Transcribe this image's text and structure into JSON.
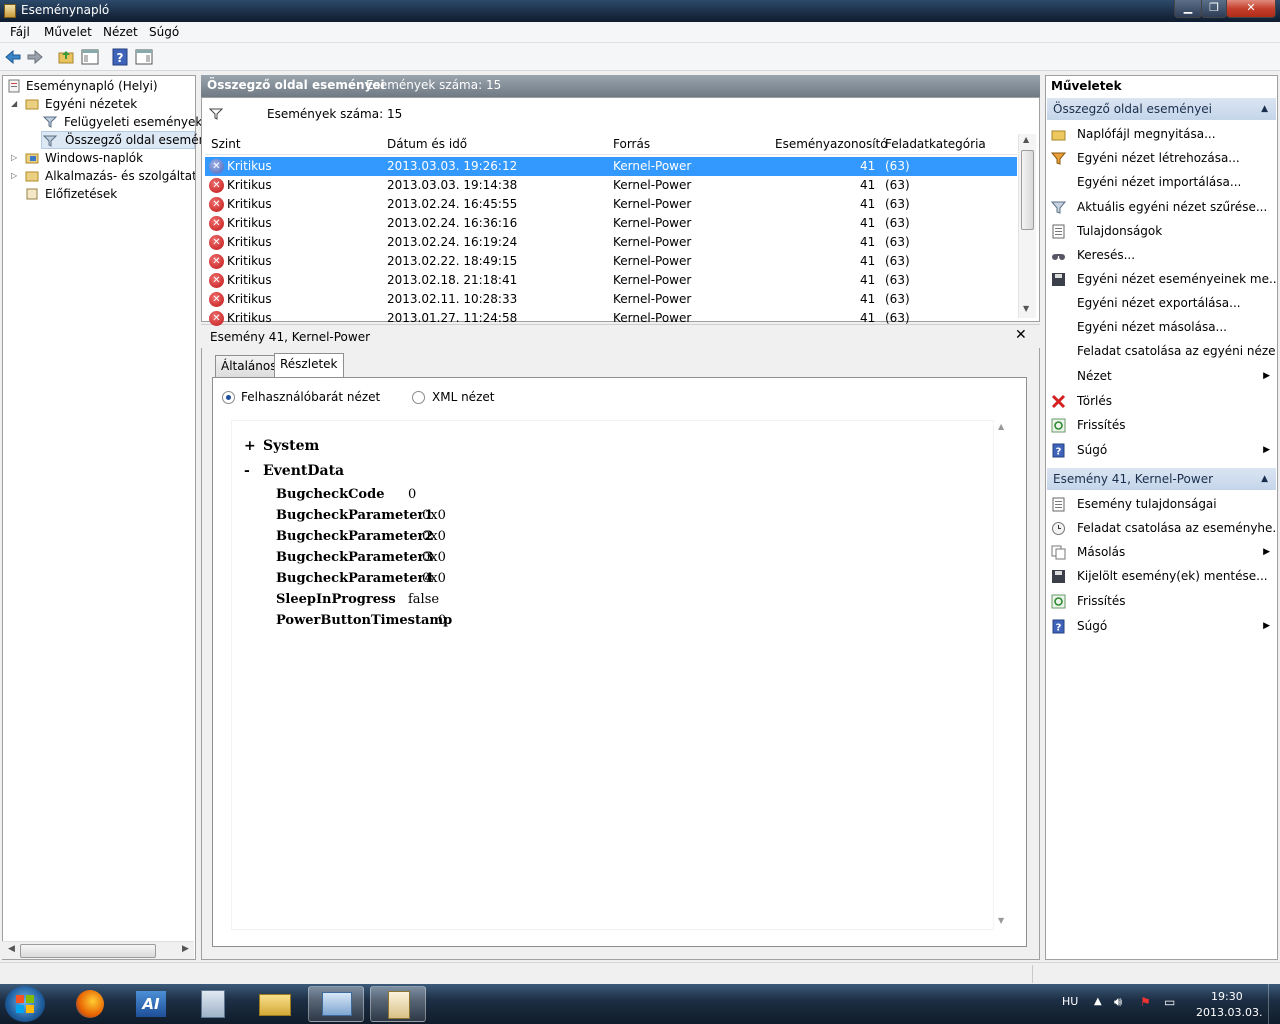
{
  "window": {
    "title": "Eseménynapló"
  },
  "menu": [
    "Fájl",
    "Művelet",
    "Nézet",
    "Súgó"
  ],
  "toolbar": {
    "buttons": [
      "back-icon",
      "forward-icon",
      "folder-up-icon",
      "show-hide-tree-icon",
      "help-icon",
      "show-hide-actions-icon"
    ]
  },
  "tree": {
    "root": "Eseménynapló (Helyi)",
    "custom_views": "Egyéni nézetek",
    "admin_events": "Felügyeleti események",
    "summary_events": "Összegző oldal eseménye",
    "windows_logs": "Windows-naplók",
    "app_service_logs": "Alkalmazás- és szolgáltatásn",
    "subscriptions": "Előfizetések"
  },
  "center": {
    "header_title": "Összegző oldal eseményei",
    "header_count": "Események száma: 15",
    "filter_text": "Események száma: 15",
    "columns": [
      "Szint",
      "Dátum és idő",
      "Forrás",
      "Eseményazonosító",
      "Feladatkategória"
    ],
    "rows": [
      {
        "level": "Kritikus",
        "datetime": "2013.03.03. 19:26:12",
        "source": "Kernel-Power",
        "id": "41",
        "category": "(63)",
        "selected": true
      },
      {
        "level": "Kritikus",
        "datetime": "2013.03.03. 19:14:38",
        "source": "Kernel-Power",
        "id": "41",
        "category": "(63)"
      },
      {
        "level": "Kritikus",
        "datetime": "2013.02.24. 16:45:55",
        "source": "Kernel-Power",
        "id": "41",
        "category": "(63)"
      },
      {
        "level": "Kritikus",
        "datetime": "2013.02.24. 16:36:16",
        "source": "Kernel-Power",
        "id": "41",
        "category": "(63)"
      },
      {
        "level": "Kritikus",
        "datetime": "2013.02.24. 16:19:24",
        "source": "Kernel-Power",
        "id": "41",
        "category": "(63)"
      },
      {
        "level": "Kritikus",
        "datetime": "2013.02.22. 18:49:15",
        "source": "Kernel-Power",
        "id": "41",
        "category": "(63)"
      },
      {
        "level": "Kritikus",
        "datetime": "2013.02.18. 21:18:41",
        "source": "Kernel-Power",
        "id": "41",
        "category": "(63)"
      },
      {
        "level": "Kritikus",
        "datetime": "2013.02.11. 10:28:33",
        "source": "Kernel-Power",
        "id": "41",
        "category": "(63)"
      },
      {
        "level": "Kritikus",
        "datetime": "2013.01.27. 11:24:58",
        "source": "Kernel-Power",
        "id": "41",
        "category": "(63)"
      }
    ]
  },
  "detail": {
    "title": "Esemény 41, Kernel-Power",
    "tabs": [
      "Általános",
      "Részletek"
    ],
    "radio_friendly": "Felhasználóbarát nézet",
    "radio_xml": "XML nézet",
    "system_sign": "+",
    "system_label": "System",
    "eventdata_sign": "-",
    "eventdata_label": "EventData",
    "fields": [
      {
        "key": "BugcheckCode",
        "value": "0"
      },
      {
        "key": "BugcheckParameter1",
        "value": "0x0"
      },
      {
        "key": "BugcheckParameter2",
        "value": "0x0"
      },
      {
        "key": "BugcheckParameter3",
        "value": "0x0"
      },
      {
        "key": "BugcheckParameter4",
        "value": "0x0"
      },
      {
        "key": "SleepInProgress",
        "value": "false"
      },
      {
        "key": "PowerButtonTimestamp",
        "value": "0"
      }
    ]
  },
  "actions": {
    "title": "Műveletek",
    "section1": "Összegző oldal eseményei",
    "items1": [
      "Naplófájl megnyitása...",
      "Egyéni nézet létrehozása...",
      "Egyéni nézet importálása...",
      "Aktuális egyéni nézet szűrése...",
      "Tulajdonságok",
      "Keresés...",
      "Egyéni nézet eseményeinek me...",
      "Egyéni nézet exportálása...",
      "Egyéni nézet másolása...",
      "Feladat csatolása az egyéni néze...",
      "Nézet",
      "Törlés",
      "Frissítés",
      "Súgó"
    ],
    "section2": "Esemény 41, Kernel-Power",
    "items2": [
      "Esemény tulajdonságai",
      "Feladat csatolása az eseményhe...",
      "Másolás",
      "Kijelölt esemény(ek) mentése...",
      "Frissítés",
      "Súgó"
    ]
  },
  "taskbar": {
    "lang": "HU",
    "time": "19:30",
    "date": "2013.03.03."
  }
}
